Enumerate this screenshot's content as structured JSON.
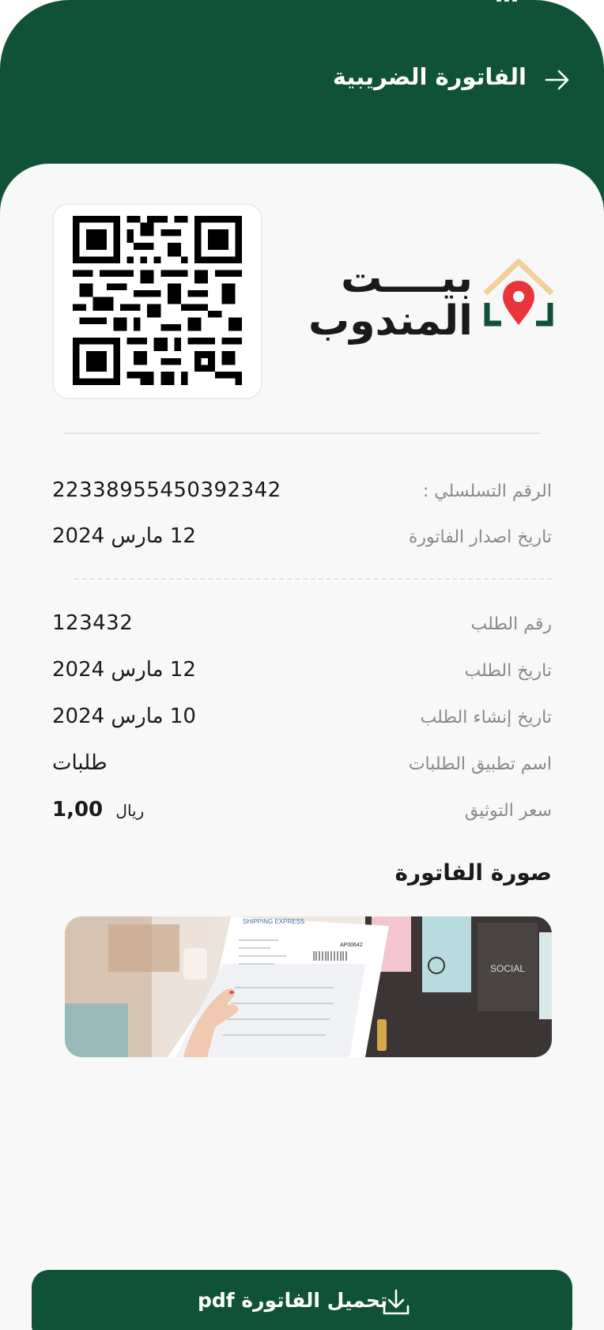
{
  "header": {
    "title": "الفاتورة الضريبية",
    "back_icon": "arrow-right-icon"
  },
  "brand": {
    "line1": "بيــــت",
    "line2": "المندوب",
    "logo_icon": "house-location-pin-icon",
    "colors": {
      "roof": "#f2cf9b",
      "pin": "#e8343a",
      "house": "#0f5238"
    }
  },
  "qr": {
    "icon": "qr-code-icon"
  },
  "details": {
    "serial_label": "الرقم التسلسلي :",
    "serial_value": "22338955450392342",
    "issue_date_label": "تاريخ اصدار الفاتورة",
    "issue_date_value": "12 مارس 2024",
    "order_no_label": "رقم الطلب",
    "order_no_value": "123432",
    "order_date_label": "تاريخ الطلب",
    "order_date_value": "12 مارس 2024",
    "created_date_label": "تاريخ إنشاء الطلب",
    "created_date_value": "10 مارس 2024",
    "app_name_label": "اسم تطبيق الطلبات",
    "app_name_value": "طلبات",
    "price_label": "سعر التوثيق",
    "price_value": "1,00",
    "price_currency": "ريال"
  },
  "invoice_image": {
    "title": "صورة الفاتورة",
    "shipping_brand": "SHIPPING EXPRESS",
    "receipt_code": "AP00642",
    "social_label": "SOCIAL"
  },
  "download": {
    "label": "تحميل الفاتورة pdf",
    "icon": "download-icon"
  },
  "colors": {
    "primary": "#0f5238",
    "background": "#f8f8f8",
    "label_gray": "#8a8a8a"
  }
}
